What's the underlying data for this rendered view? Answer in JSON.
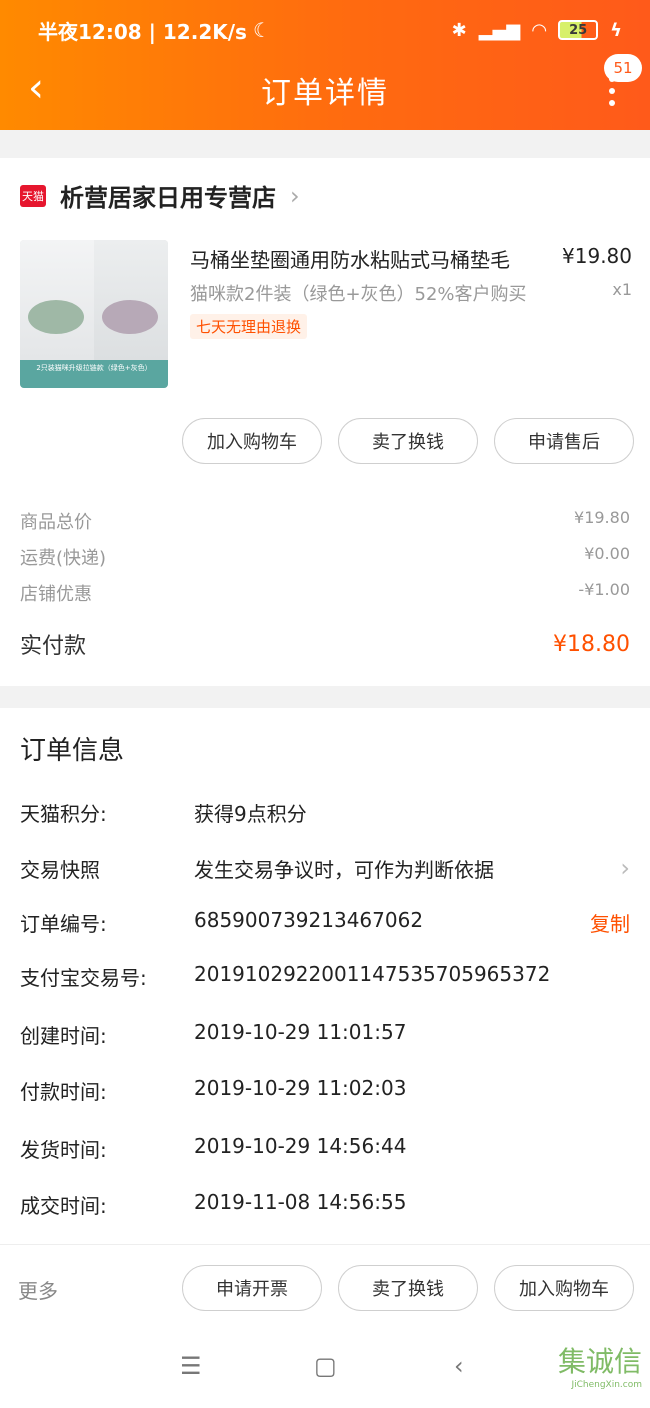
{
  "status_bar": {
    "time_speed": "半夜12:08 | 12.2K/s",
    "battery": "25"
  },
  "nav": {
    "title": "订单详情",
    "badge_count": "51"
  },
  "store": {
    "name": "析营居家日用专营店",
    "logo_text": "天猫"
  },
  "product": {
    "title": "马桶坐垫圈通用防水粘贴式马桶垫毛",
    "sku": "猫咪款2件装（绿色+灰色）52%客户购买",
    "tag": "七天无理由退换",
    "price": "¥19.80",
    "qty": "x1",
    "image_banner": "2只装猫咪升级拉链款（绿色+灰色）"
  },
  "product_actions": [
    "加入购物车",
    "卖了换钱",
    "申请售后"
  ],
  "summary": {
    "rows": [
      {
        "label": "商品总价",
        "value": "¥19.80"
      },
      {
        "label": "运费(快递)",
        "value": "¥0.00"
      },
      {
        "label": "店铺优惠",
        "value": "-¥1.00"
      }
    ],
    "paid_label": "实付款",
    "paid_value": "¥18.80"
  },
  "order_info": {
    "title": "订单信息",
    "rows": [
      {
        "label": "天猫积分:",
        "value": "获得9点积分"
      },
      {
        "label": "交易快照",
        "value": "发生交易争议时，可作为判断依据"
      },
      {
        "label": "订单编号:",
        "value": "685900739213467062",
        "action": "复制"
      },
      {
        "label": "支付宝交易号:",
        "value": "2019102922001147535705965372"
      },
      {
        "label": "创建时间:",
        "value": "2019-10-29 11:01:57"
      },
      {
        "label": "付款时间:",
        "value": "2019-10-29 11:02:03"
      },
      {
        "label": "发货时间:",
        "value": "2019-10-29 14:56:44"
      },
      {
        "label": "成交时间:",
        "value": "2019-11-08 14:56:55"
      }
    ]
  },
  "footer": {
    "more_label": "更多",
    "buttons": [
      "申请开票",
      "卖了换钱",
      "加入购物车"
    ]
  },
  "watermark": {
    "text": "集诚信",
    "sub": "JiChengXin.com"
  }
}
